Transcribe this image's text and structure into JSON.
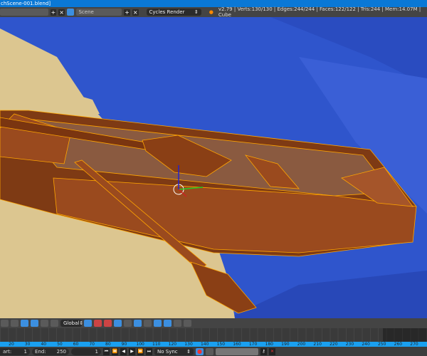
{
  "window": {
    "title": "chScene-001.blend]"
  },
  "info": {
    "scene": "Scene",
    "render_engine": "Cycles Render",
    "stats": "v2.79 | Verts:130/130 | Edges:244/244 | Faces:122/122 | Tris:244 | Mem:14.07M | Cube",
    "add": "+",
    "close": "×"
  },
  "header3d": {
    "orientation": "Global"
  },
  "timeline": {
    "ticks": [
      "20",
      "30",
      "40",
      "50",
      "60",
      "70",
      "80",
      "90",
      "100",
      "110",
      "120",
      "130",
      "140",
      "150",
      "160",
      "170",
      "180",
      "190",
      "200",
      "210",
      "220",
      "230",
      "240",
      "250",
      "260",
      "270"
    ]
  },
  "playback": {
    "start_label": "art:",
    "start": "1",
    "end_label": "End:",
    "end": "250",
    "current": "1",
    "sync": "No Sync"
  },
  "colors": {
    "sky": "#2f55cc",
    "sand": "#dcc690",
    "wood": "#9a4a1e",
    "edge": "#ffa500",
    "ruler": "#1aa0f0"
  }
}
